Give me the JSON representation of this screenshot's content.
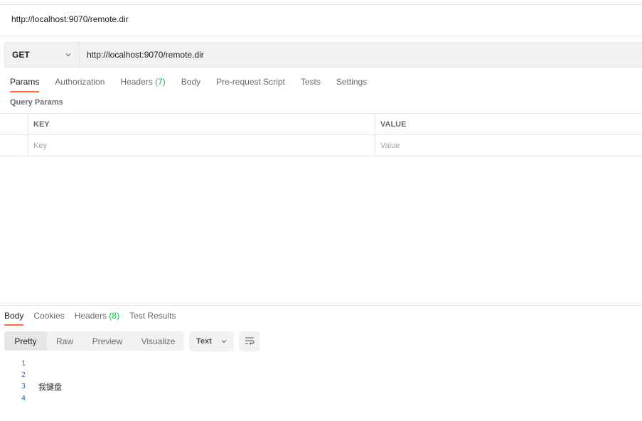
{
  "request": {
    "title": "http://localhost:9070/remote.dir",
    "method": "GET",
    "url": "http://localhost:9070/remote.dir"
  },
  "request_tabs": {
    "params": "Params",
    "authorization": "Authorization",
    "headers": "Headers",
    "headers_count": "(7)",
    "body": "Body",
    "prerequest": "Pre-request Script",
    "tests": "Tests",
    "settings": "Settings"
  },
  "query_params": {
    "label": "Query Params",
    "key_header": "KEY",
    "value_header": "VALUE",
    "key_placeholder": "Key",
    "value_placeholder": "Value"
  },
  "response_tabs": {
    "body": "Body",
    "cookies": "Cookies",
    "headers": "Headers",
    "headers_count": "(8)",
    "test_results": "Test Results"
  },
  "response_view": {
    "pretty": "Pretty",
    "raw": "Raw",
    "preview": "Preview",
    "visualize": "Visualize",
    "language": "Text"
  },
  "response_body": {
    "lines": [
      {
        "num": "1",
        "text": ""
      },
      {
        "num": "2",
        "text": ""
      },
      {
        "num": "3",
        "text": "我键盘"
      },
      {
        "num": "4",
        "text": ""
      }
    ]
  },
  "colors": {
    "accent": "#ff6c37",
    "count": "#0cbb52",
    "line_number": "#1f6fb2"
  },
  "icons": {
    "method_dropdown": "chevron-down-icon",
    "language_dropdown": "chevron-down-icon",
    "wrap": "wrap-lines-icon"
  }
}
